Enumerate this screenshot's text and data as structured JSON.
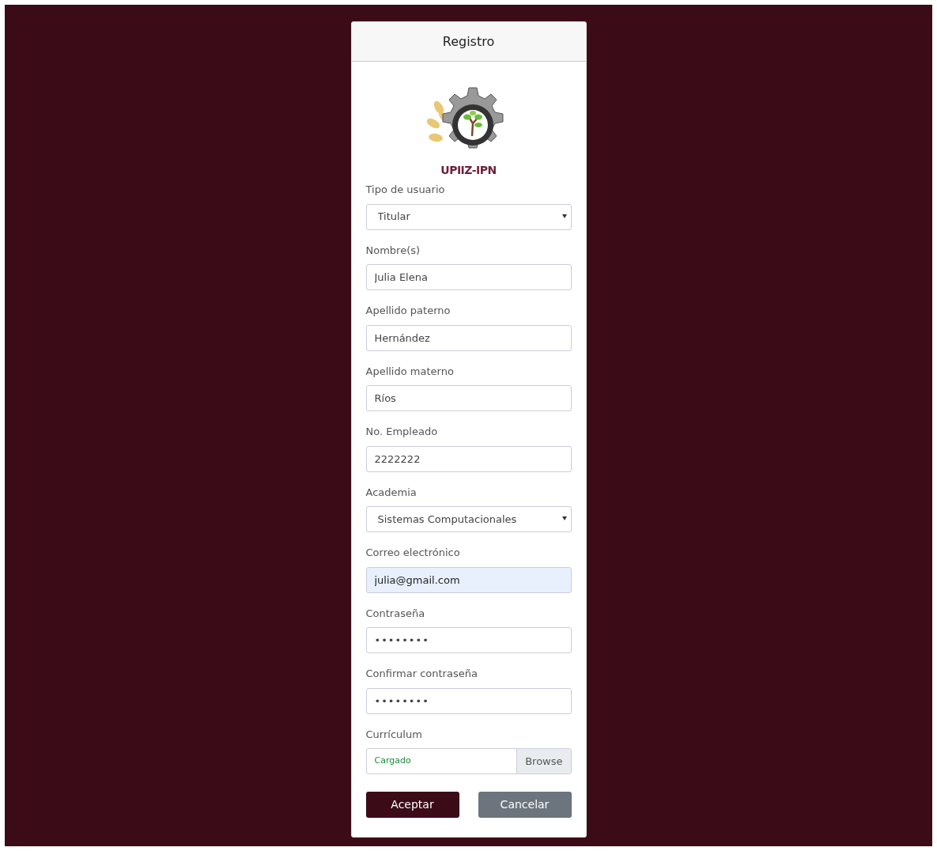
{
  "card": {
    "title": "Registro"
  },
  "logo": {
    "text": "UPIIZ-IPN"
  },
  "fields": [
    {
      "kind": "select",
      "label": "Tipo de usuario",
      "value": "Titular",
      "autofilled": false
    },
    {
      "kind": "text",
      "label": "Nombre(s)",
      "value": "Julia Elena",
      "autofilled": false
    },
    {
      "kind": "text",
      "label": "Apellido paterno",
      "value": "Hernández",
      "autofilled": false
    },
    {
      "kind": "text",
      "label": "Apellido materno",
      "value": "Ríos",
      "autofilled": false
    },
    {
      "kind": "text",
      "label": "No. Empleado",
      "value": "2222222",
      "autofilled": false
    },
    {
      "kind": "select",
      "label": "Academia",
      "value": "Sistemas Computacionales",
      "autofilled": false
    },
    {
      "kind": "text",
      "label": "Correo electrónico",
      "value": "julia@gmail.com",
      "autofilled": true
    },
    {
      "kind": "password",
      "label": "Contraseña",
      "value": "••••••••",
      "autofilled": false
    },
    {
      "kind": "password",
      "label": "Confirmar contraseña",
      "value": "••••••••",
      "autofilled": false
    },
    {
      "kind": "file",
      "label": "Currículum",
      "value": "Cargado",
      "button": "Browse",
      "autofilled": false
    }
  ],
  "buttons": [
    {
      "label": "Aceptar",
      "kind": "primary"
    },
    {
      "label": "Cancelar",
      "kind": "secondary"
    }
  ]
}
